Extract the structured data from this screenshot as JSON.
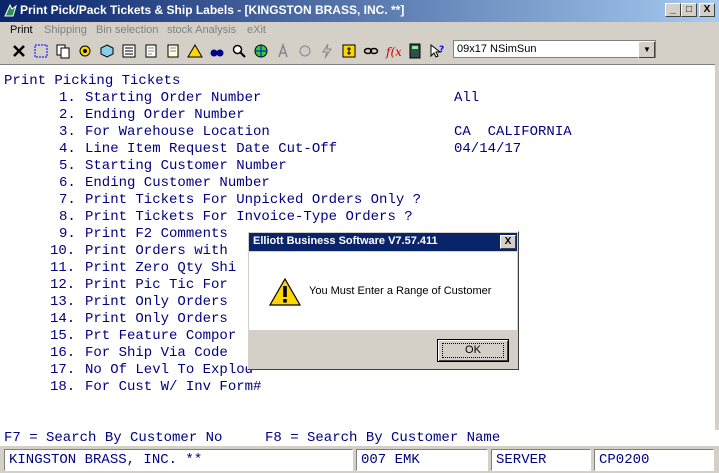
{
  "window": {
    "title": "Print Pick/Pack Tickets & Ship Labels - [KINGSTON BRASS, INC. **]",
    "controls": {
      "minimize": "_",
      "maximize": "□",
      "close": "X"
    }
  },
  "menu": [
    {
      "label": "Print",
      "enabled": true
    },
    {
      "label": "Shipping",
      "enabled": false
    },
    {
      "label": "Bin selection",
      "enabled": false
    },
    {
      "label": "stock Analysis",
      "enabled": false
    },
    {
      "label": "eXit",
      "enabled": false
    }
  ],
  "toolbar": {
    "icons": [
      "x-icon",
      "dotted-select-icon",
      "copy-icon",
      "gears-icon",
      "cube-icon",
      "list-icon",
      "document-icon",
      "warning-icon",
      "search-icon",
      "binoculars-icon",
      "globe-icon",
      "text-a-icon",
      "paint-icon",
      "lightning-icon",
      "money-icon",
      "link-icon",
      "function-icon",
      "calculator-icon",
      "help-pointer-icon"
    ],
    "font_value": "09x17 NSimSun"
  },
  "screen": {
    "heading": "Print Picking Tickets",
    "lines": [
      {
        "num": "1.",
        "label": "Starting Order Number",
        "value": "All"
      },
      {
        "num": "2.",
        "label": "Ending Order Number",
        "value": ""
      },
      {
        "num": "3.",
        "label": "For Warehouse Location",
        "value": "CA  CALIFORNIA"
      },
      {
        "num": "4.",
        "label": "Line Item Request Date Cut-Off",
        "value": "04/14/17"
      },
      {
        "num": "5.",
        "label": "Starting Customer Number",
        "value": ""
      },
      {
        "num": "6.",
        "label": "Ending Customer Number",
        "value": ""
      },
      {
        "num": "7.",
        "label": "Print Tickets For Unpicked Orders Only ?",
        "value": ""
      },
      {
        "num": "8.",
        "label": "Print Tickets For Invoice-Type Orders ?",
        "value": ""
      },
      {
        "num": "9.",
        "label": "Print F2 Comments",
        "value": ""
      },
      {
        "num": "10.",
        "label": "Print Orders with",
        "value": ""
      },
      {
        "num": "11.",
        "label": "Print Zero Qty Shi",
        "value": ""
      },
      {
        "num": "12.",
        "label": "Print Pic Tic For",
        "value": ""
      },
      {
        "num": "13.",
        "label": "Print Only Orders",
        "value": ""
      },
      {
        "num": "14.",
        "label": "Print Only Orders",
        "value": ""
      },
      {
        "num": "15.",
        "label": "Prt Feature Compor",
        "value": ""
      },
      {
        "num": "16.",
        "label": "For Ship Via Code",
        "value": ""
      },
      {
        "num": "17.",
        "label": "No Of Levl To Explod",
        "value": ""
      },
      {
        "num": "18.",
        "label": "For Cust W/ Inv Form#",
        "value": ""
      }
    ]
  },
  "function_keys": {
    "f7": "F7 = Search By Customer No",
    "f8": "F8 = Search By Customer Name"
  },
  "status": {
    "company": "KINGSTON BRASS, INC. **",
    "user": "007 EMK",
    "server": "SERVER",
    "program": "CP0200"
  },
  "dialog": {
    "title": "Elliott Business Software V7.57.411",
    "message": "You Must Enter a Range of Customer",
    "ok_label": "OK",
    "close_label": "X"
  }
}
